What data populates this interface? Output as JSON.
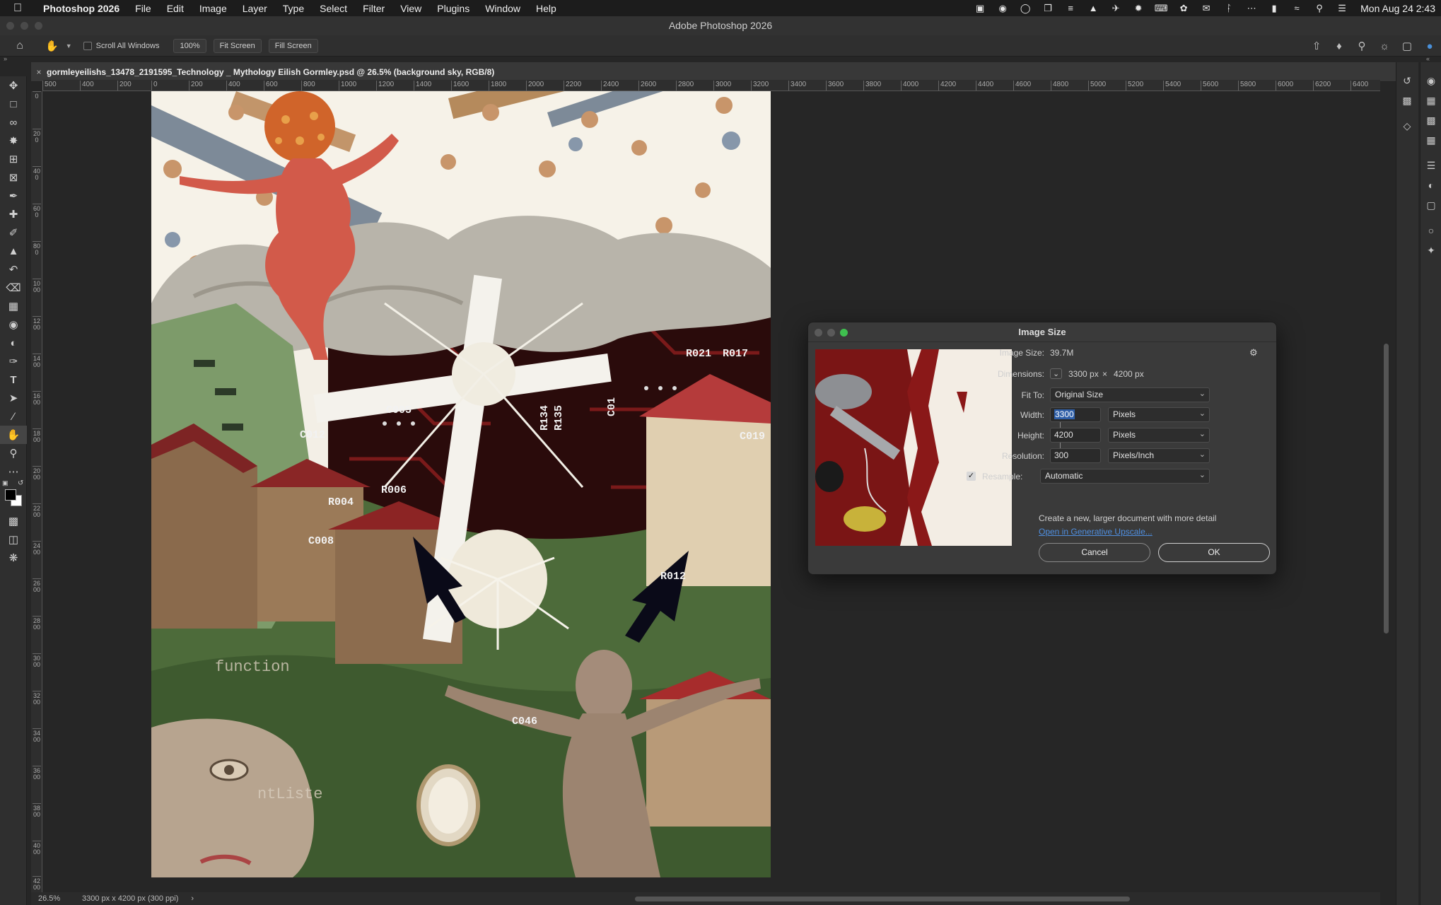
{
  "menubar": {
    "app_name": "Photoshop 2026",
    "items": [
      "File",
      "Edit",
      "Image",
      "Layer",
      "Type",
      "Select",
      "Filter",
      "View",
      "Plugins",
      "Window",
      "Help"
    ],
    "clock": "Mon Aug 24  2:43"
  },
  "window": {
    "title": "Adobe Photoshop 2026"
  },
  "options_bar": {
    "scroll_all_windows_label": "Scroll All Windows",
    "zoom_100_label": "100%",
    "fit_screen_label": "Fit Screen",
    "fill_screen_label": "Fill Screen"
  },
  "document": {
    "tab_title": "gormleyeilishs_13478_2191595_Technology _ Mythology Eilish Gormley.psd @ 26.5% (background sky, RGB/8)"
  },
  "ruler": {
    "horizontal_labels": [
      "500",
      "400",
      "200",
      "0",
      "200",
      "400",
      "600",
      "800",
      "1000",
      "1200",
      "1400",
      "1600",
      "1800",
      "2000",
      "2200",
      "2400",
      "2600",
      "2800",
      "3000",
      "3200",
      "3400",
      "3600",
      "3800",
      "4000",
      "4200",
      "4400",
      "4600",
      "4800",
      "5000",
      "5200",
      "5400",
      "5600",
      "5800",
      "6000",
      "6200",
      "6400"
    ],
    "vertical_labels": [
      "0",
      "200",
      "400",
      "600",
      "800",
      "1000",
      "1200",
      "1400",
      "1600",
      "1800",
      "2000",
      "2200",
      "2400",
      "2600",
      "2800",
      "3000",
      "3200",
      "3400",
      "3600",
      "3800",
      "4000",
      "4200"
    ]
  },
  "dialog": {
    "title": "Image Size",
    "image_size_label": "Image Size:",
    "image_size_value": "39.7M",
    "dimensions_label": "Dimensions:",
    "dimensions_width": "3300 px",
    "dimensions_sep": "×",
    "dimensions_height": "4200 px",
    "fit_to_label": "Fit To:",
    "fit_to_value": "Original Size",
    "width_label": "Width:",
    "width_value": "3300",
    "width_unit": "Pixels",
    "height_label": "Height:",
    "height_value": "4200",
    "height_unit": "Pixels",
    "resolution_label": "Resolution:",
    "resolution_value": "300",
    "resolution_unit": "Pixels/Inch",
    "resample_label": "Resample:",
    "resample_checked": true,
    "resample_value": "Automatic",
    "upscale_text": "Create a new, larger document with more detail",
    "upscale_link": "Open in Generative Upscale...",
    "cancel_label": "Cancel",
    "ok_label": "OK"
  },
  "status_bar": {
    "zoom": "26.5%",
    "doc_info": "3300 px x 4200 px (300 ppi)",
    "arrow": "›"
  },
  "artwork_labels": {
    "c005": "C005",
    "r021": "R021",
    "r017": "R017",
    "c019": "C019",
    "r004": "R004",
    "r006": "R006",
    "c008": "C008",
    "r012": "R012",
    "c012": "C012",
    "r134": "R134",
    "r135": "R135",
    "c01": "C01",
    "c046": "C046",
    "code1": "function",
    "code2": "ntListe"
  }
}
